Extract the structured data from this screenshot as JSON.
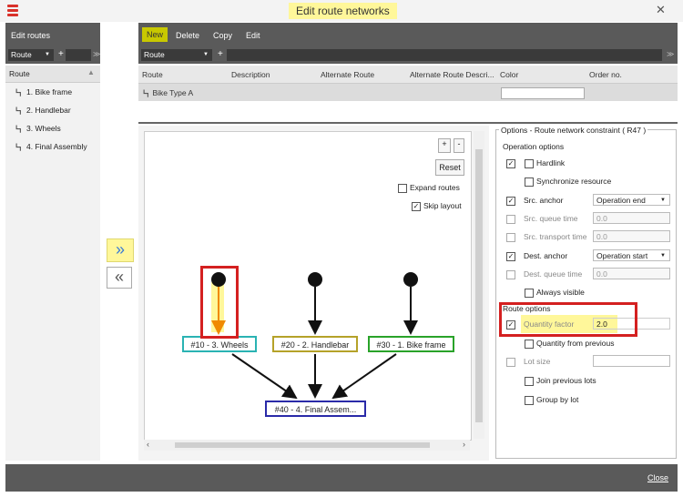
{
  "window": {
    "title": "Edit route networks",
    "close_label": "Close"
  },
  "left_panel": {
    "header": "Edit routes",
    "route_select": "Route",
    "add": "+",
    "column_header": "Route",
    "items": [
      {
        "label": "1. Bike frame"
      },
      {
        "label": "2. Handlebar"
      },
      {
        "label": "3. Wheels"
      },
      {
        "label": "4. Final Assembly"
      }
    ]
  },
  "transfer": {
    "move_right": "»",
    "move_left": "«"
  },
  "toolbar": {
    "new": "New",
    "delete": "Delete",
    "copy": "Copy",
    "edit": "Edit"
  },
  "route_filter": {
    "select": "Route",
    "add": "+"
  },
  "table": {
    "headers": [
      "Route",
      "Description",
      "Alternate Route",
      "Alternate Route Descri...",
      "Color",
      "Order no."
    ],
    "row": {
      "route": "Bike Type A",
      "description": "",
      "alt_route": "",
      "alt_desc": "",
      "color": "#ffffff",
      "order": ""
    }
  },
  "canvas": {
    "zoom_in": "+",
    "zoom_out": "-",
    "reset": "Reset",
    "expand_routes": "Expand routes",
    "skip_layout": "Skip layout",
    "nodes": [
      {
        "label": "#10 - 3. Wheels",
        "color": "#2ab3b3"
      },
      {
        "label": "#20 - 2. Handlebar",
        "color": "#b5a229"
      },
      {
        "label": "#30 - 1. Bike frame",
        "color": "#29a329"
      },
      {
        "label": "#40 - 4. Final Assem...",
        "color": "#2a2aa8"
      }
    ],
    "highlight_edge_color": "#f08a00"
  },
  "options": {
    "title": "Options - Route network constraint ( R47 )",
    "operation_header": "Operation options",
    "hardlink": "Hardlink",
    "sync_resource": "Synchronize resource",
    "src_anchor": "Src. anchor",
    "src_anchor_value": "Operation end",
    "src_queue": "Src. queue time",
    "src_queue_value": "0.0",
    "src_transport": "Src. transport time",
    "src_transport_value": "0.0",
    "dest_anchor": "Dest. anchor",
    "dest_anchor_value": "Operation start",
    "dest_queue": "Dest. queue time",
    "dest_queue_value": "0.0",
    "always_visible": "Always visible",
    "route_header": "Route options",
    "quantity_factor": "Quantity factor",
    "quantity_factor_value": "2.0",
    "qty_from_prev": "Quantity from previous",
    "lot_size": "Lot size",
    "join_prev": "Join previous lots",
    "group_lot": "Group by lot"
  }
}
